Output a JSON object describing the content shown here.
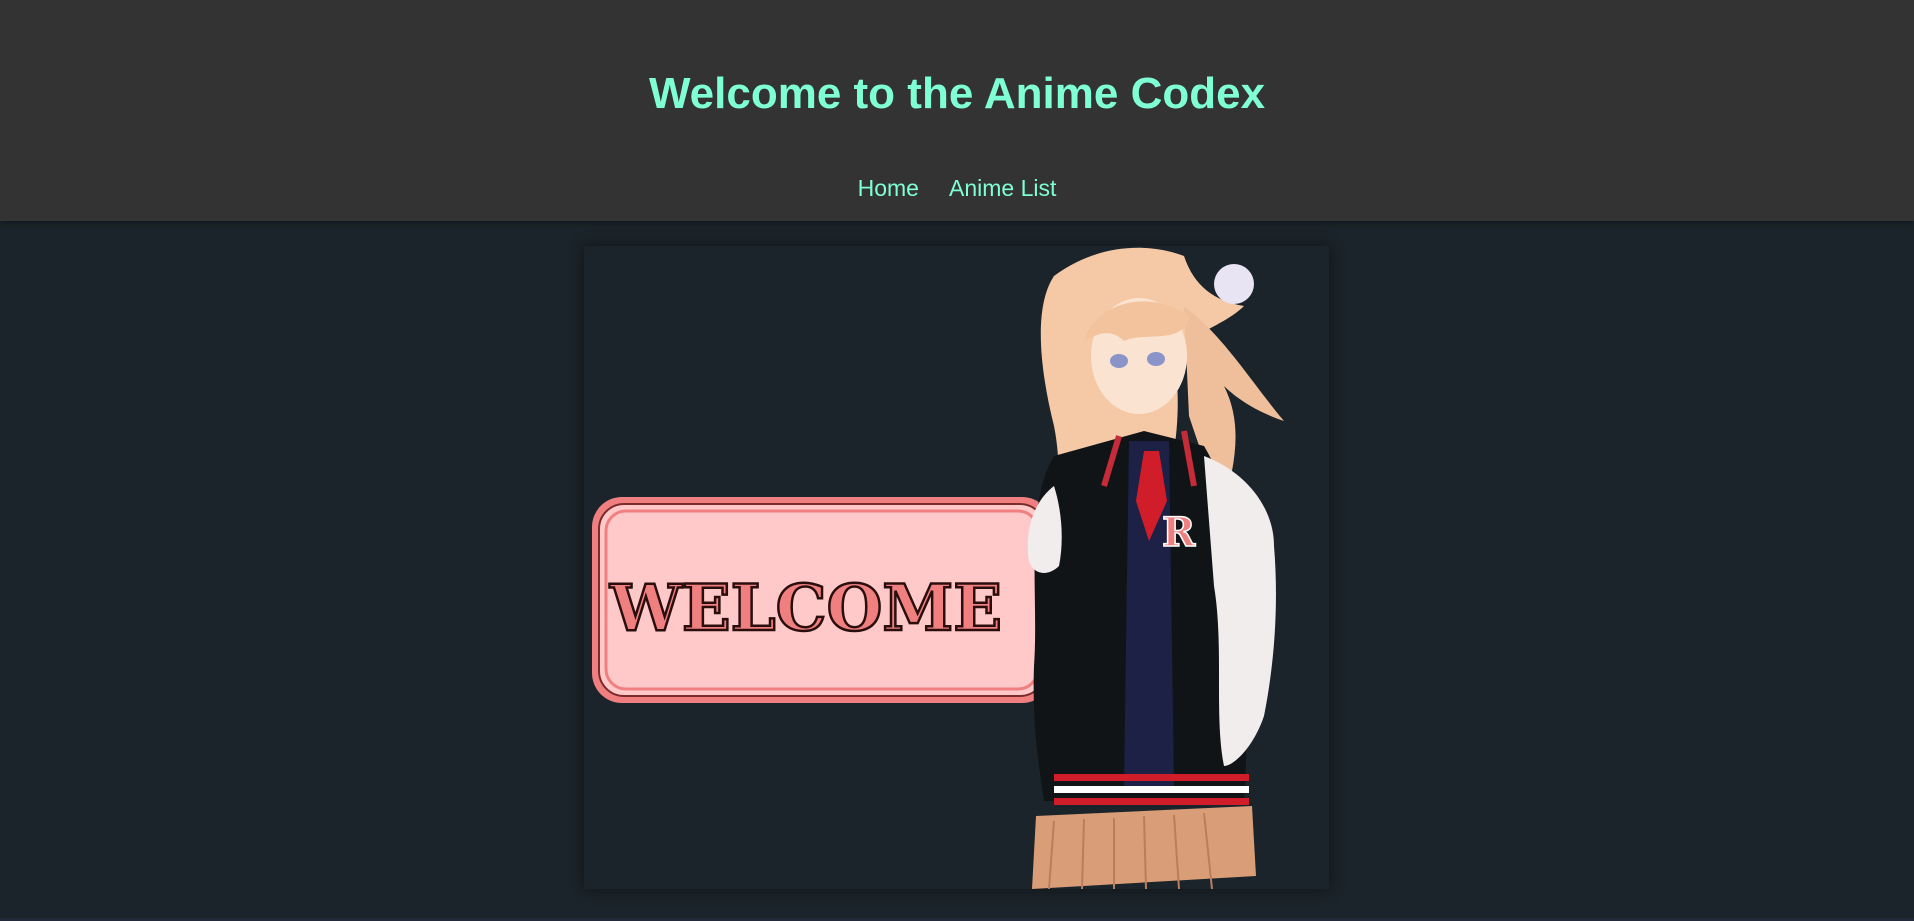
{
  "header": {
    "title": "Welcome to the Anime Codex",
    "nav": [
      {
        "label": "Home"
      },
      {
        "label": "Anime List"
      }
    ]
  },
  "hero": {
    "banner_text": "WELCOME",
    "letter_icon": "R",
    "colors": {
      "banner_fill": "#ffc9c9",
      "banner_border": "#f08080",
      "accent": "#7fffd4",
      "page_bg": "#1b242a",
      "header_bg": "#333333"
    }
  }
}
